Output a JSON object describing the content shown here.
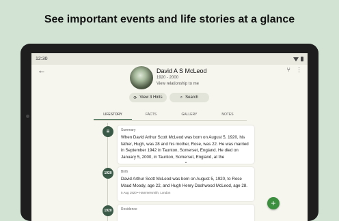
{
  "headline": "See important events and life stories at a glance",
  "status": {
    "time": "12:30"
  },
  "profile": {
    "name": "David A S McLeod",
    "dates": "1920 - 2000",
    "relationship_link": "View relationship to me",
    "hints_label": "View 3 Hints",
    "search_label": "Search"
  },
  "tabs": [
    "LIFESTORY",
    "FACTS",
    "GALLERY",
    "NOTES"
  ],
  "timeline": [
    {
      "badge": "",
      "title": "Summary",
      "text": "When David Arthur Scott McLeod was born on August 5, 1920, his father, Hugh, was 28 and his mother, Rose, was 22. He was married in September 1942 in Taunton, Somerset, England. He died on January 5, 2000, in Taunton, Somerset, England, at the"
    },
    {
      "badge": "1920",
      "title": "Birth",
      "text": "David Arthur Scott McLeod was born on August 5, 1920, to Rose Maud Moody, age 22, and Hugh Henry Dashwood McLeod, age 28.",
      "meta": "5 Aug 1920 • Hammersmith, London"
    },
    {
      "badge": "1920",
      "title": "Residence"
    }
  ],
  "icons": {
    "back": "arrow-left",
    "tree": "family-tree",
    "menu": "more-vertical",
    "fab": "plus"
  },
  "colors": {
    "accent": "#3a5a47",
    "fab": "#3b8f3f"
  }
}
